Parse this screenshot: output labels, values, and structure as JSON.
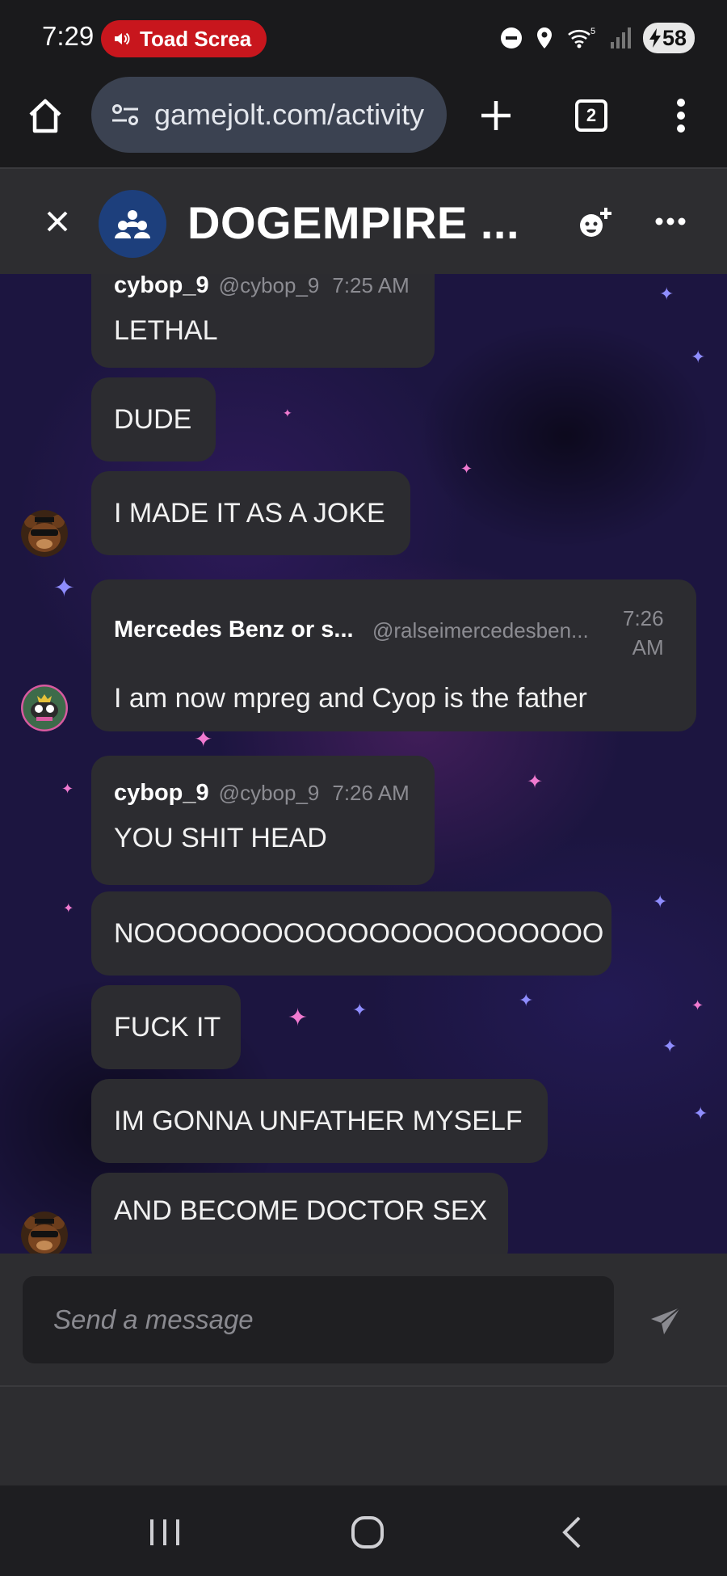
{
  "status_bar": {
    "time": "7:29",
    "recording_label": "Toad Screa",
    "battery": "58",
    "signal": "5"
  },
  "browser": {
    "url": "gamejolt.com/activity",
    "tab_count": "2"
  },
  "chat": {
    "title": "DOGEMPIRE ...",
    "messages": [
      {
        "name": "cybop_9",
        "handle": "@cybop_9",
        "time": "7:25 AM",
        "text": "LETHAL"
      },
      {
        "text": "DUDE"
      },
      {
        "text": "I MADE IT AS A JOKE"
      },
      {
        "name": "Mercedes Benz or s...",
        "handle": "@ralseimercedesben...",
        "time_line1": "7:26",
        "time_line2": "AM",
        "text": "I am now mpreg and Cyop is the father"
      },
      {
        "name": "cybop_9",
        "handle": "@cybop_9",
        "time": "7:26 AM",
        "text": "YOU SHIT HEAD"
      },
      {
        "text": "NOOOOOOOOOOOOOOOOOOOOOO"
      },
      {
        "text": "FUCK IT"
      },
      {
        "text": "IM GONNA UNFATHER MYSELF"
      },
      {
        "text": "AND BECOME DOCTOR SEX"
      }
    ]
  },
  "composer": {
    "placeholder": "Send a message"
  },
  "colors": {
    "bubble": "#2c2c30",
    "header": "#2d2d30",
    "url_pill": "#3b4251",
    "rec_pill": "#c8161d",
    "chat_avatar": "#1d3f7c"
  }
}
